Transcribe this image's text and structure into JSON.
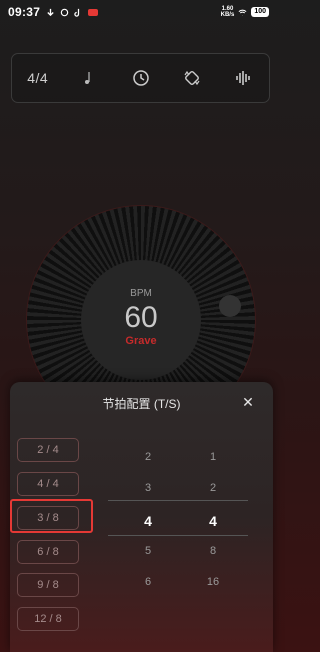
{
  "status_bar": {
    "time": "09:37",
    "net_top": "1.60",
    "net_bottom": "KB/s",
    "battery": "100"
  },
  "toolbar": {
    "time_signature": "4/4",
    "icons": [
      "note-icon",
      "clock-icon",
      "rotate-icon",
      "sound-wave-icon"
    ]
  },
  "dial": {
    "bpm_label": "BPM",
    "bpm_value": "60",
    "tempo_name": "Grave"
  },
  "sheet": {
    "title": "节拍配置 (T/S)",
    "close_symbol": "✕",
    "presets": [
      "2 / 4",
      "4 / 4",
      "3 / 8",
      "6 / 8",
      "9 / 8",
      "12 / 8"
    ],
    "picker_left": [
      "2",
      "3",
      "4",
      "5",
      "6"
    ],
    "picker_right": [
      "1",
      "2",
      "4",
      "8",
      "16"
    ]
  },
  "colors": {
    "accent_red": "#c52b2b",
    "highlight_red": "#e53935"
  }
}
